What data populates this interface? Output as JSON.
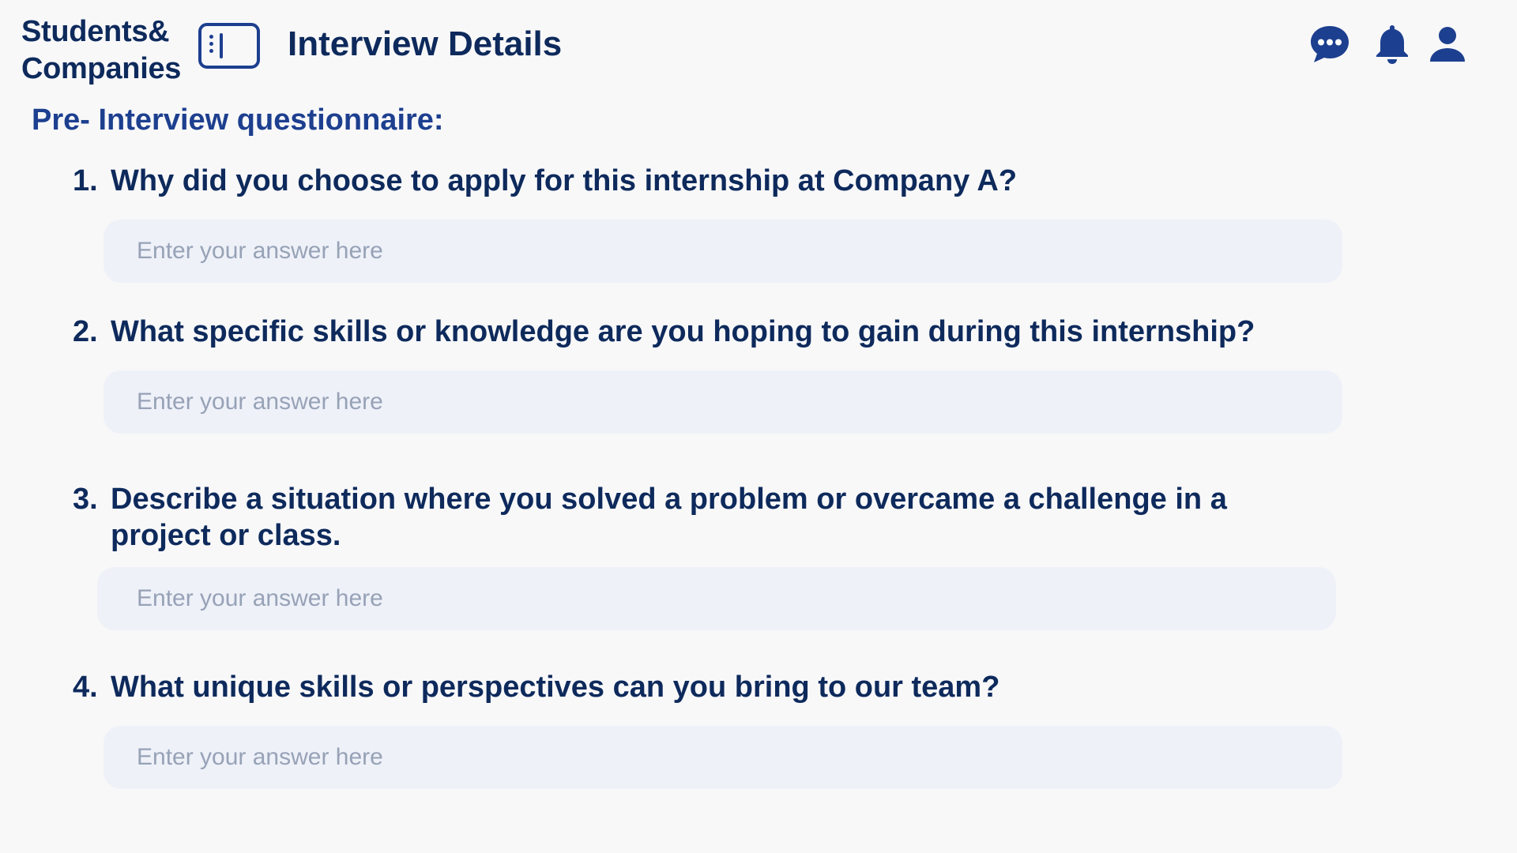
{
  "header": {
    "logo_line1": "Students&",
    "logo_line2": "Companies",
    "page_title": "Interview Details",
    "icons": [
      "chat-icon",
      "bell-icon",
      "user-icon"
    ]
  },
  "questionnaire": {
    "title": "Pre- Interview questionnaire:",
    "questions": [
      {
        "number": "1.",
        "text": "Why did you choose to apply for this internship at Company A?",
        "answer_placeholder": "Enter your answer here",
        "answer_value": ""
      },
      {
        "number": "2.",
        "text": "What specific skills or knowledge are you hoping to gain during this internship?",
        "answer_placeholder": "Enter your answer here",
        "answer_value": ""
      },
      {
        "number": "3.",
        "text": "Describe a situation where you solved a problem or overcame a challenge in a project or class.",
        "answer_placeholder": "Enter your answer here",
        "answer_value": ""
      },
      {
        "number": "4.",
        "text": "What unique skills or perspectives can you bring to our team?",
        "answer_placeholder": "Enter your answer here",
        "answer_value": ""
      }
    ]
  },
  "colors": {
    "primary": "#1d3f8f",
    "text_dark": "#0e2a5c",
    "background": "#f8f8f9",
    "input_background": "#eef1f8",
    "placeholder": "#97a2b7"
  }
}
